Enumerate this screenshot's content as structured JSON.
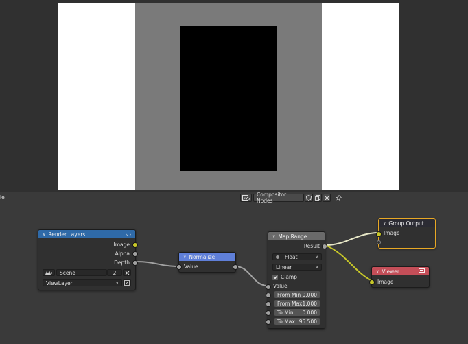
{
  "editor_edge_label": "le",
  "header": {
    "tree_type_icon": "node-tree-icon",
    "tree_name": "Compositor Nodes",
    "fake_user_icon": "shield-icon",
    "duplicate_icon": "copy-icon",
    "close_icon": "close-icon",
    "pin_icon": "pin-icon"
  },
  "render_layers": {
    "title": "Render Layers",
    "outputs": [
      "Image",
      "Alpha",
      "Depth"
    ],
    "scene": "Scene",
    "scene_users": "2",
    "view_layer": "ViewLayer"
  },
  "normalize": {
    "title": "Normalize",
    "output": "Value"
  },
  "map_range": {
    "title": "Map Range",
    "output": "Result",
    "data_type": "Float",
    "interpolation": "Linear",
    "clamp_label": "Clamp",
    "clamp_checked": true,
    "value_label": "Value",
    "fields": [
      {
        "label": "From Min",
        "value": "0.000"
      },
      {
        "label": "From Max",
        "value": "1.000"
      },
      {
        "label": "To Min",
        "value": "0.000"
      },
      {
        "label": "To Max",
        "value": "95.500"
      }
    ]
  },
  "group_output": {
    "title": "Group Output",
    "input": "Image"
  },
  "viewer": {
    "title": "Viewer",
    "input": "Image"
  },
  "colors": {
    "render_layers_header": "#2f6aa8",
    "normalize_header": "#5f7fd8",
    "map_range_header": "#6a6a6a",
    "viewer_header": "#c44e58",
    "group_output_header": "#2b2b33",
    "group_output_border": "#e8a825",
    "socket_color": "#c7c729",
    "socket_float": "#a1a1a1"
  }
}
